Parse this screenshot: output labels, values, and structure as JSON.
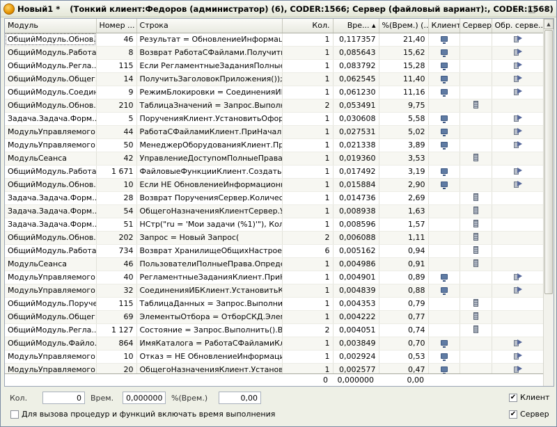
{
  "window": {
    "title": "Новый1 *",
    "subtitle": "(Тонкий клиент:Федоров (администратор) (6), CODER:1566; Сервер (файловый вариант):, CODER:1568)",
    "controls": {
      "minimize": "–",
      "restore": "□",
      "close": "✕"
    }
  },
  "columns": [
    {
      "label": "Модуль",
      "align": "l"
    },
    {
      "label": "Номер ...",
      "align": "l"
    },
    {
      "label": "Строка",
      "align": "l"
    },
    {
      "label": "Кол.",
      "align": "r"
    },
    {
      "label": "Вре... ▴",
      "align": "r"
    },
    {
      "label": "%(Врем.) (...",
      "align": "r"
    },
    {
      "label": "Клиент",
      "align": "l"
    },
    {
      "label": "Сервер",
      "align": "l"
    },
    {
      "label": "Обр. серве...",
      "align": "l"
    }
  ],
  "rows": [
    {
      "module": "ОбщийМодуль.Обнов...",
      "line_no": "46",
      "code": "Результат = ОбновлениеИнформаци...",
      "count": "1",
      "time": "0,117357",
      "pct": "21,40",
      "client": "client-icon",
      "server": "",
      "srv_call": "server-call-icon"
    },
    {
      "module": "ОбщийМодуль.Работа...",
      "line_no": "8",
      "code": "Возврат РаботаСФайлами.Получить...",
      "count": "1",
      "time": "0,085643",
      "pct": "15,62",
      "client": "client-icon",
      "server": "",
      "srv_call": "server-call-icon"
    },
    {
      "module": "ОбщийМодуль.Регла...",
      "line_no": "115",
      "code": "Если РегламентныеЗаданияПолные...",
      "count": "1",
      "time": "0,083792",
      "pct": "15,28",
      "client": "client-icon",
      "server": "",
      "srv_call": "server-call-icon"
    },
    {
      "module": "ОбщийМодуль.Общег...",
      "line_no": "14",
      "code": "ПолучитьЗаголовокПриложения());",
      "count": "1",
      "time": "0,062545",
      "pct": "11,40",
      "client": "client-icon",
      "server": "",
      "srv_call": "server-call-icon"
    },
    {
      "module": "ОбщийМодуль.Соедин...",
      "line_no": "9",
      "code": "РежимБлокировки = СоединенияИБ....",
      "count": "1",
      "time": "0,061230",
      "pct": "11,16",
      "client": "client-icon",
      "server": "",
      "srv_call": "server-call-icon"
    },
    {
      "module": "ОбщийМодуль.Обнов...",
      "line_no": "210",
      "code": "ТаблицаЗначений = Запрос.Выполни...",
      "count": "2",
      "time": "0,053491",
      "pct": "9,75",
      "client": "",
      "server": "server-icon",
      "srv_call": ""
    },
    {
      "module": "Задача.Задача.Форм...",
      "line_no": "5",
      "code": "ПорученияКлиент.УстановитьОформ...",
      "count": "1",
      "time": "0,030608",
      "pct": "5,58",
      "client": "client-icon",
      "server": "",
      "srv_call": "server-call-icon"
    },
    {
      "module": "МодульУправляемого...",
      "line_no": "44",
      "code": "РаботаСФайламиКлиент.ПриНачале...",
      "count": "1",
      "time": "0,027531",
      "pct": "5,02",
      "client": "client-icon",
      "server": "",
      "srv_call": "server-call-icon"
    },
    {
      "module": "МодульУправляемого...",
      "line_no": "50",
      "code": "МенеджерОборудованияКлиент.При...",
      "count": "1",
      "time": "0,021338",
      "pct": "3,89",
      "client": "client-icon",
      "server": "",
      "srv_call": "server-call-icon"
    },
    {
      "module": "МодульСеанса",
      "line_no": "42",
      "code": "УправлениеДоступомПолныеПрава....",
      "count": "1",
      "time": "0,019360",
      "pct": "3,53",
      "client": "",
      "server": "server-icon",
      "srv_call": ""
    },
    {
      "module": "ОбщийМодуль.Работа...",
      "line_no": "1 671",
      "code": "ФайловыеФункцииКлиент.СоздатьР...",
      "count": "1",
      "time": "0,017492",
      "pct": "3,19",
      "client": "client-icon",
      "server": "",
      "srv_call": "server-call-icon"
    },
    {
      "module": "ОбщийМодуль.Обнов...",
      "line_no": "10",
      "code": "Если НЕ ОбновлениеИнформационн...",
      "count": "1",
      "time": "0,015884",
      "pct": "2,90",
      "client": "client-icon",
      "server": "",
      "srv_call": "server-call-icon"
    },
    {
      "module": "Задача.Задача.Форм...",
      "line_no": "28",
      "code": "Возврат ПорученияСервер.Количест...",
      "count": "1",
      "time": "0,014736",
      "pct": "2,69",
      "client": "",
      "server": "server-icon",
      "srv_call": ""
    },
    {
      "module": "Задача.Задача.Форм...",
      "line_no": "54",
      "code": "ОбщегоНазначенияКлиентСервер.У...",
      "count": "1",
      "time": "0,008938",
      "pct": "1,63",
      "client": "",
      "server": "server-icon",
      "srv_call": ""
    },
    {
      "module": "Задача.Задача.Форм...",
      "line_no": "51",
      "code": "НСтр(\"ru = 'Мои задачи (%1)'\"), Колич...",
      "count": "1",
      "time": "0,008596",
      "pct": "1,57",
      "client": "",
      "server": "server-icon",
      "srv_call": ""
    },
    {
      "module": "ОбщийМодуль.Обнов...",
      "line_no": "202",
      "code": "Запрос = Новый Запрос(",
      "count": "2",
      "time": "0,006088",
      "pct": "1,11",
      "client": "",
      "server": "server-icon",
      "srv_call": ""
    },
    {
      "module": "ОбщийМодуль.Работа...",
      "line_no": "734",
      "code": "Возврат ХранилищеОбщихНастроек....",
      "count": "6",
      "time": "0,005162",
      "pct": "0,94",
      "client": "",
      "server": "server-icon",
      "srv_call": ""
    },
    {
      "module": "МодульСеанса",
      "line_no": "46",
      "code": "ПользователиПолныеПрава.Опреде...",
      "count": "1",
      "time": "0,004986",
      "pct": "0,91",
      "client": "",
      "server": "server-icon",
      "srv_call": ""
    },
    {
      "module": "МодульУправляемого...",
      "line_no": "40",
      "code": "РегламентныеЗаданияКлиент.ПриН...",
      "count": "1",
      "time": "0,004901",
      "pct": "0,89",
      "client": "client-icon",
      "server": "",
      "srv_call": "server-call-icon"
    },
    {
      "module": "МодульУправляемого...",
      "line_no": "32",
      "code": "СоединенияИБКлиент.УстановитьКо...",
      "count": "1",
      "time": "0,004839",
      "pct": "0,88",
      "client": "client-icon",
      "server": "",
      "srv_call": "server-call-icon"
    },
    {
      "module": "ОбщийМодуль.Поруче...",
      "line_no": "115",
      "code": "ТаблицаДанных = Запрос.Выполнит...",
      "count": "1",
      "time": "0,004353",
      "pct": "0,79",
      "client": "",
      "server": "server-icon",
      "srv_call": ""
    },
    {
      "module": "ОбщийМодуль.Общег...",
      "line_no": "69",
      "code": "ЭлементыОтбора = ОтборСКД.Элем...",
      "count": "1",
      "time": "0,004222",
      "pct": "0,77",
      "client": "",
      "server": "server-icon",
      "srv_call": ""
    },
    {
      "module": "ОбщийМодуль.Регла...",
      "line_no": "1 127",
      "code": "Состояние = Запрос.Выполнить().Вы...",
      "count": "2",
      "time": "0,004051",
      "pct": "0,74",
      "client": "",
      "server": "server-icon",
      "srv_call": ""
    },
    {
      "module": "ОбщийМодуль.Файло...",
      "line_no": "864",
      "code": "ИмяКаталога = РаботаСФайламиКл...",
      "count": "1",
      "time": "0,003849",
      "pct": "0,70",
      "client": "client-icon",
      "server": "",
      "srv_call": "server-call-icon"
    },
    {
      "module": "МодульУправляемого...",
      "line_no": "10",
      "code": "Отказ = НЕ ОбновлениеИнформацио...",
      "count": "1",
      "time": "0,002924",
      "pct": "0,53",
      "client": "client-icon",
      "server": "",
      "srv_call": "server-call-icon"
    },
    {
      "module": "МодульУправляемого...",
      "line_no": "20",
      "code": "ОбщегоНазначенияКлиент.Установи...",
      "count": "1",
      "time": "0,002577",
      "pct": "0,47",
      "client": "client-icon",
      "server": "",
      "srv_call": "server-call-icon"
    }
  ],
  "totals": {
    "count": "0",
    "time": "0,000000",
    "pct": "0,00"
  },
  "footer": {
    "count_label": "Кол.",
    "count_value": "0",
    "time_label": "Врем.",
    "time_value": "0,000000",
    "pct_label": "%(Врем.)",
    "pct_value": "0,00",
    "client_checkbox": {
      "label": "Клиент",
      "checked": true
    },
    "server_checkbox": {
      "label": "Сервер",
      "checked": true
    },
    "include_time_checkbox": {
      "label": "Для вызова процедур и функций включать время выполнения",
      "checked": false
    }
  }
}
